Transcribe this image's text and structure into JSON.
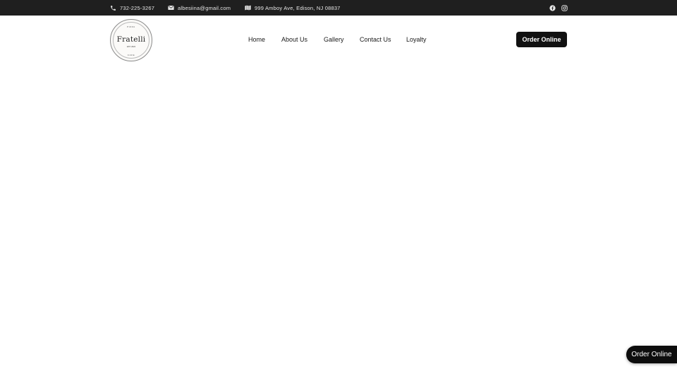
{
  "topbar": {
    "phone": "732-225-3267",
    "email": "albesiina@gmail.com",
    "address": "999 Amboy Ave, Edison, NJ 08837",
    "icons": {
      "phone": "phone-icon",
      "email": "envelope-icon",
      "address": "map-icon",
      "facebook": "facebook-icon",
      "instagram": "instagram-icon"
    }
  },
  "logo": {
    "brand": "Fratelli",
    "top_text": "PIZZA",
    "est_text": "EST. 2024",
    "bottom_text": "CAFE"
  },
  "nav": {
    "items": [
      "Home",
      "About Us",
      "Gallery",
      "Contact Us",
      "Loyalty"
    ]
  },
  "header": {
    "order_button": "Order Online"
  },
  "floating": {
    "order_button": "Order Online"
  },
  "colors": {
    "topbar_bg": "#1f1f1f",
    "button_bg": "#111111",
    "text": "#1a1a1a"
  }
}
